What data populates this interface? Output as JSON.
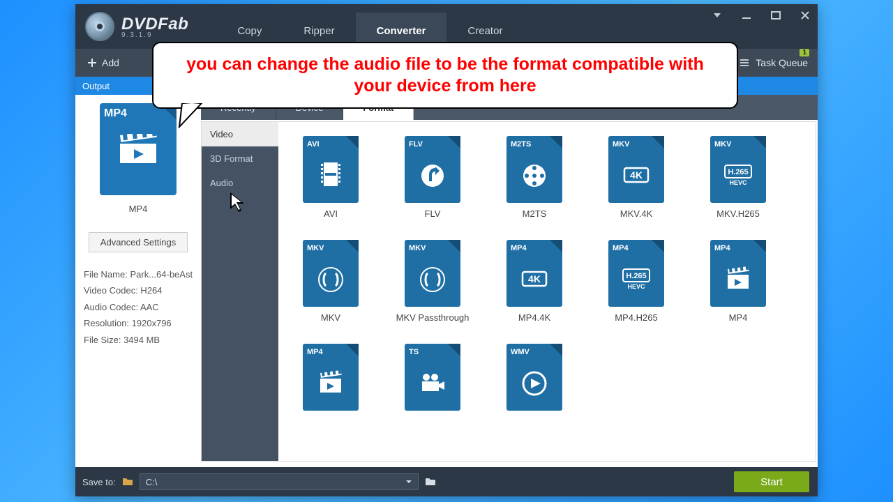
{
  "brand": {
    "name": "DVDFab",
    "version": "9.3.1.9"
  },
  "top_tabs": {
    "copy": "Copy",
    "ripper": "Ripper",
    "converter": "Converter",
    "creator": "Creator"
  },
  "toolbar": {
    "add": "Add",
    "task_queue": "Task Queue",
    "task_count": "1"
  },
  "output_strip": "Output",
  "side": {
    "tile_tag": "MP4",
    "tile_label": "MP4",
    "adv": "Advanced Settings",
    "meta": {
      "file_name": "File Name: Park...64-beAst",
      "video_codec": "Video Codec: H264",
      "audio_codec": "Audio Codec: AAC",
      "resolution": "Resolution: 1920x796",
      "file_size": "File Size: 3494 MB"
    }
  },
  "tabs": {
    "recently": "Recently",
    "device": "Device",
    "format": "Format"
  },
  "categories": {
    "video": "Video",
    "threeD": "3D Format",
    "audio": "Audio"
  },
  "formats": {
    "r1": [
      {
        "tag": "AVI",
        "label": "AVI",
        "glyph": "film"
      },
      {
        "tag": "FLV",
        "label": "FLV",
        "glyph": "flash"
      },
      {
        "tag": "M2TS",
        "label": "M2TS",
        "glyph": "reel"
      },
      {
        "tag": "MKV",
        "label": "MKV.4K",
        "glyph": "4k"
      },
      {
        "tag": "MKV",
        "label": "MKV.H265",
        "glyph": "h265"
      }
    ],
    "r2": [
      {
        "tag": "MKV",
        "label": "MKV",
        "glyph": "mk"
      },
      {
        "tag": "MKV",
        "label": "MKV Passthrough",
        "glyph": "mk"
      },
      {
        "tag": "MP4",
        "label": "MP4.4K",
        "glyph": "4k"
      },
      {
        "tag": "MP4",
        "label": "MP4.H265",
        "glyph": "h265"
      },
      {
        "tag": "MP4",
        "label": "MP4",
        "glyph": "clap"
      }
    ],
    "r3": [
      {
        "tag": "MP4",
        "label": "",
        "glyph": "clap"
      },
      {
        "tag": "TS",
        "label": "",
        "glyph": "cam"
      },
      {
        "tag": "WMV",
        "label": "",
        "glyph": "play"
      }
    ]
  },
  "bottom": {
    "save_to": "Save to:",
    "path": "C:\\",
    "start": "Start"
  },
  "bubble": "you can change the audio file to be the format compatible with your device from here"
}
